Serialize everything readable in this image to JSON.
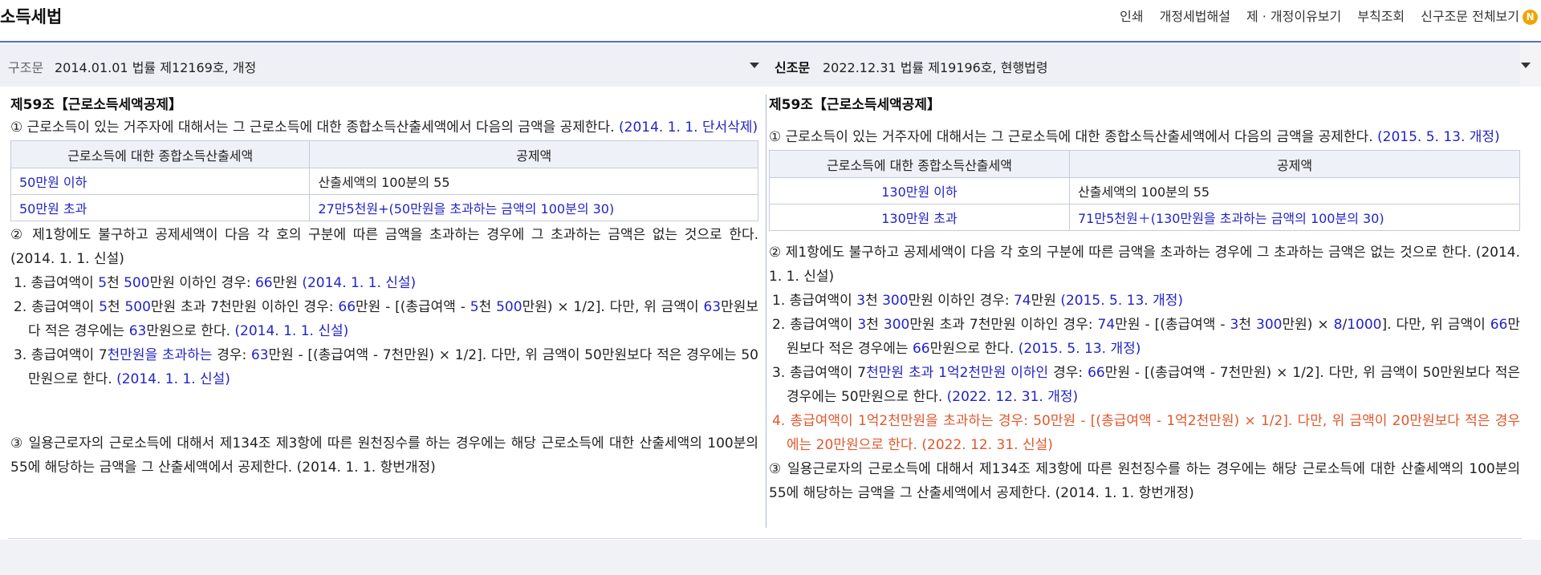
{
  "header": {
    "title": "소득세법",
    "menu": [
      "인쇄",
      "개정세법해설",
      "제 · 개정이유보기",
      "부칙조회",
      "신구조문 전체보기"
    ],
    "new_badge": "N"
  },
  "old_version": {
    "label": "구조문",
    "selected": "2014.01.01 법률 제12169호, 개정"
  },
  "new_version": {
    "label": "신조문",
    "selected": "2022.12.31 법률 제19196호, 현행법령"
  },
  "old": {
    "article_title": "제59조【근로소득세액공제】",
    "p1_text": "① 근로소득이 있는 거주자에 대해서는 그 근로소득에 대한 종합소득산출세액에서 다음의 금액을 공제한다. ",
    "p1_note": "(2014. 1. 1. 단서삭제)",
    "table": {
      "headers": [
        "근로소득에 대한 종합소득산출세액",
        "공제액"
      ],
      "rows": [
        [
          "50만원 이하",
          "산출세액의 100분의 55"
        ],
        [
          "50만원 초과",
          "27만5천원+(50만원을 초과하는 금액의 100분의 30)"
        ]
      ]
    },
    "p2_text": "② 제1항에도 불구하고 공제세액이 다음 각 호의 구분에 따른 금액을 초과하는 경우에 그 초과하는 금액은 없는 것으로 한다. (2014. 1. 1. 신설)",
    "i1": {
      "a": "1. 총급여액이 ",
      "b": "5",
      "c": "천 ",
      "d": "500",
      "e": "만원 이하인 경우: ",
      "f": "66",
      "g": "만원 ",
      "h": "(2014. 1. 1. 신설)"
    },
    "i2": {
      "a": "2. 총급여액이 ",
      "b": "5",
      "c": "천 ",
      "d": "500",
      "e": "만원 초과 7천만원 이하인 경우: ",
      "f": "66",
      "g": "만원 - [(총급여액 - ",
      "h": "5",
      "i": "천 ",
      "j": "500",
      "k": "만원) × 1/2]. 다만, 위 금액이 ",
      "l": "63",
      "m": "만원보다 적은 경우에는 ",
      "n": "63",
      "o": "만원으로 한다. ",
      "p": "(2014. 1. 1. 신설)"
    },
    "i3": {
      "a": "3. 총급여액이 7",
      "b": "천만원을 초과하는",
      "c": " 경우: ",
      "d": "63",
      "e": "만원 - [(총급여액 - 7천만원) × 1/2]. 다만, 위 금액이 50만원보다 적은 경우에는 50만원으로 한다. ",
      "f": "(2014. 1. 1. 신설)"
    },
    "p3_text": "③ 일용근로자의 근로소득에 대해서 제134조 제3항에 따른 원천징수를 하는 경우에는 해당 근로소득에 대한 산출세액의 100분의 55에 해당하는 금액을 그 산출세액에서 공제한다. (2014. 1. 1. 항번개정)"
  },
  "new": {
    "article_title": "제59조【근로소득세액공제】",
    "p1_text": "① 근로소득이 있는 거주자에 대해서는 그 근로소득에 대한 종합소득산출세액에서 다음의 금액을 공제한다. ",
    "p1_note": "(2015. 5. 13. 개정)",
    "table": {
      "headers": [
        "근로소득에 대한 종합소득산출세액",
        "공제액"
      ],
      "rows": [
        [
          "130만원 이하",
          "산출세액의 100분의 55"
        ],
        [
          "130만원 초과",
          "71만5천원＋(130만원을 초과하는 금액의 100분의 30)"
        ]
      ]
    },
    "p2_text": "② 제1항에도 불구하고 공제세액이 다음 각 호의 구분에 따른 금액을 초과하는 경우에 그 초과하는 금액은 없는 것으로 한다. (2014. 1. 1. 신설)",
    "i1": {
      "a": "1. 총급여액이 ",
      "b": "3",
      "c": "천 ",
      "d": "300",
      "e": "만원 이하인 경우: ",
      "f": "74",
      "g": "만원 ",
      "h": "(2015. 5. 13. 개정)"
    },
    "i2": {
      "a": "2. 총급여액이 ",
      "b": "3",
      "c": "천 ",
      "d": "300",
      "e": "만원 초과 7천만원 이하인 경우: ",
      "f": "74",
      "g": "만원 - [(총급여액 - ",
      "h": "3",
      "i": "천 ",
      "j": "300",
      "k": "만원) × ",
      "l": "8",
      "m": "/",
      "n": "1000",
      "o": "]. 다만, 위 금액이 ",
      "p": "66",
      "q": "만원보다 적은 경우에는 ",
      "r": "66",
      "s": "만원으로 한다. ",
      "t": "(2015. 5. 13. 개정)"
    },
    "i3": {
      "a": "3. 총급여액이 7",
      "b": "천만원 초과 1억2천만원 이하인",
      "c": " 경우: ",
      "d": "66",
      "e": "만원 - [(총급여액 - 7천만원) × 1/2]. 다만, 위 금액이 50만원보다 적은 경우에는 50만원으로 한다. ",
      "f": "(2022. 12. 31. 개정)"
    },
    "i4_text": "4. 총급여액이 1억2천만원을 초과하는 경우: 50만원 - [(총급여액 - 1억2천만원) × 1/2]. 다만, 위 금액이 20만원보다 적은 경우에는 20만원으로 한다. (2022. 12. 31. 신설)",
    "p3_text": "③ 일용근로자의 근로소득에 대해서 제134조 제3항에 따른 원천징수를 하는 경우에는 해당 근로소득에 대한 산출세액의 100분의 55에 해당하는 금액을 그 산출세액에서 공제한다. (2014. 1. 1. 항번개정)"
  }
}
